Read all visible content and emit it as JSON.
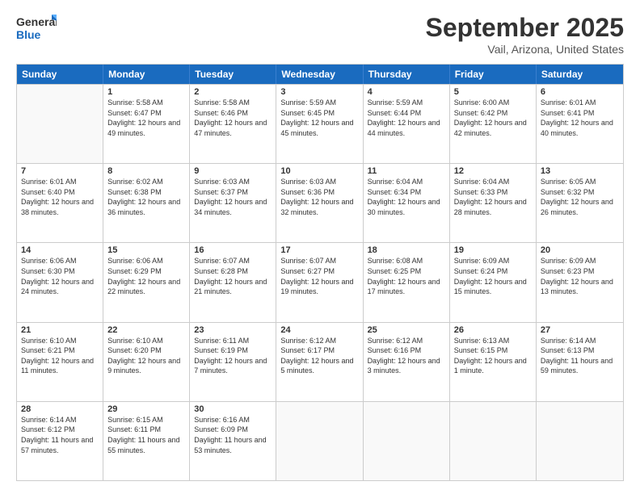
{
  "logo": {
    "line1": "General",
    "line2": "Blue"
  },
  "title": "September 2025",
  "location": "Vail, Arizona, United States",
  "days_of_week": [
    "Sunday",
    "Monday",
    "Tuesday",
    "Wednesday",
    "Thursday",
    "Friday",
    "Saturday"
  ],
  "weeks": [
    [
      {
        "num": "",
        "empty": true
      },
      {
        "num": "1",
        "sunrise": "5:58 AM",
        "sunset": "6:47 PM",
        "daylight": "12 hours and 49 minutes."
      },
      {
        "num": "2",
        "sunrise": "5:58 AM",
        "sunset": "6:46 PM",
        "daylight": "12 hours and 47 minutes."
      },
      {
        "num": "3",
        "sunrise": "5:59 AM",
        "sunset": "6:45 PM",
        "daylight": "12 hours and 45 minutes."
      },
      {
        "num": "4",
        "sunrise": "5:59 AM",
        "sunset": "6:44 PM",
        "daylight": "12 hours and 44 minutes."
      },
      {
        "num": "5",
        "sunrise": "6:00 AM",
        "sunset": "6:42 PM",
        "daylight": "12 hours and 42 minutes."
      },
      {
        "num": "6",
        "sunrise": "6:01 AM",
        "sunset": "6:41 PM",
        "daylight": "12 hours and 40 minutes."
      }
    ],
    [
      {
        "num": "7",
        "sunrise": "6:01 AM",
        "sunset": "6:40 PM",
        "daylight": "12 hours and 38 minutes."
      },
      {
        "num": "8",
        "sunrise": "6:02 AM",
        "sunset": "6:38 PM",
        "daylight": "12 hours and 36 minutes."
      },
      {
        "num": "9",
        "sunrise": "6:03 AM",
        "sunset": "6:37 PM",
        "daylight": "12 hours and 34 minutes."
      },
      {
        "num": "10",
        "sunrise": "6:03 AM",
        "sunset": "6:36 PM",
        "daylight": "12 hours and 32 minutes."
      },
      {
        "num": "11",
        "sunrise": "6:04 AM",
        "sunset": "6:34 PM",
        "daylight": "12 hours and 30 minutes."
      },
      {
        "num": "12",
        "sunrise": "6:04 AM",
        "sunset": "6:33 PM",
        "daylight": "12 hours and 28 minutes."
      },
      {
        "num": "13",
        "sunrise": "6:05 AM",
        "sunset": "6:32 PM",
        "daylight": "12 hours and 26 minutes."
      }
    ],
    [
      {
        "num": "14",
        "sunrise": "6:06 AM",
        "sunset": "6:30 PM",
        "daylight": "12 hours and 24 minutes."
      },
      {
        "num": "15",
        "sunrise": "6:06 AM",
        "sunset": "6:29 PM",
        "daylight": "12 hours and 22 minutes."
      },
      {
        "num": "16",
        "sunrise": "6:07 AM",
        "sunset": "6:28 PM",
        "daylight": "12 hours and 21 minutes."
      },
      {
        "num": "17",
        "sunrise": "6:07 AM",
        "sunset": "6:27 PM",
        "daylight": "12 hours and 19 minutes."
      },
      {
        "num": "18",
        "sunrise": "6:08 AM",
        "sunset": "6:25 PM",
        "daylight": "12 hours and 17 minutes."
      },
      {
        "num": "19",
        "sunrise": "6:09 AM",
        "sunset": "6:24 PM",
        "daylight": "12 hours and 15 minutes."
      },
      {
        "num": "20",
        "sunrise": "6:09 AM",
        "sunset": "6:23 PM",
        "daylight": "12 hours and 13 minutes."
      }
    ],
    [
      {
        "num": "21",
        "sunrise": "6:10 AM",
        "sunset": "6:21 PM",
        "daylight": "12 hours and 11 minutes."
      },
      {
        "num": "22",
        "sunrise": "6:10 AM",
        "sunset": "6:20 PM",
        "daylight": "12 hours and 9 minutes."
      },
      {
        "num": "23",
        "sunrise": "6:11 AM",
        "sunset": "6:19 PM",
        "daylight": "12 hours and 7 minutes."
      },
      {
        "num": "24",
        "sunrise": "6:12 AM",
        "sunset": "6:17 PM",
        "daylight": "12 hours and 5 minutes."
      },
      {
        "num": "25",
        "sunrise": "6:12 AM",
        "sunset": "6:16 PM",
        "daylight": "12 hours and 3 minutes."
      },
      {
        "num": "26",
        "sunrise": "6:13 AM",
        "sunset": "6:15 PM",
        "daylight": "12 hours and 1 minute."
      },
      {
        "num": "27",
        "sunrise": "6:14 AM",
        "sunset": "6:13 PM",
        "daylight": "11 hours and 59 minutes."
      }
    ],
    [
      {
        "num": "28",
        "sunrise": "6:14 AM",
        "sunset": "6:12 PM",
        "daylight": "11 hours and 57 minutes."
      },
      {
        "num": "29",
        "sunrise": "6:15 AM",
        "sunset": "6:11 PM",
        "daylight": "11 hours and 55 minutes."
      },
      {
        "num": "30",
        "sunrise": "6:16 AM",
        "sunset": "6:09 PM",
        "daylight": "11 hours and 53 minutes."
      },
      {
        "num": "",
        "empty": true
      },
      {
        "num": "",
        "empty": true
      },
      {
        "num": "",
        "empty": true
      },
      {
        "num": "",
        "empty": true
      }
    ]
  ],
  "labels": {
    "sunrise_prefix": "Sunrise: ",
    "sunset_prefix": "Sunset: ",
    "daylight_prefix": "Daylight: "
  }
}
